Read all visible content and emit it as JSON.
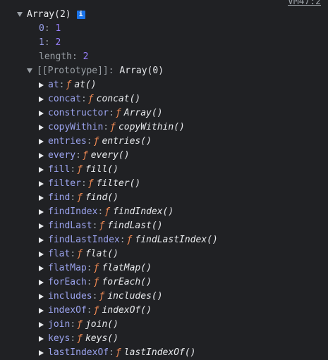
{
  "source_link": "VM47:2",
  "array_header": "Array(2)",
  "info_badge": "i",
  "entries": [
    {
      "key": "0",
      "value": "1"
    },
    {
      "key": "1",
      "value": "2"
    }
  ],
  "length": {
    "key": "length",
    "value": "2"
  },
  "prototype": {
    "key": "[[Prototype]]",
    "value": "Array(0)"
  },
  "function_symbol": "ƒ",
  "methods": [
    {
      "key": "at",
      "sig": "at()"
    },
    {
      "key": "concat",
      "sig": "concat()"
    },
    {
      "key": "constructor",
      "sig": "Array()"
    },
    {
      "key": "copyWithin",
      "sig": "copyWithin()"
    },
    {
      "key": "entries",
      "sig": "entries()"
    },
    {
      "key": "every",
      "sig": "every()"
    },
    {
      "key": "fill",
      "sig": "fill()"
    },
    {
      "key": "filter",
      "sig": "filter()"
    },
    {
      "key": "find",
      "sig": "find()"
    },
    {
      "key": "findIndex",
      "sig": "findIndex()"
    },
    {
      "key": "findLast",
      "sig": "findLast()"
    },
    {
      "key": "findLastIndex",
      "sig": "findLastIndex()"
    },
    {
      "key": "flat",
      "sig": "flat()"
    },
    {
      "key": "flatMap",
      "sig": "flatMap()"
    },
    {
      "key": "forEach",
      "sig": "forEach()"
    },
    {
      "key": "includes",
      "sig": "includes()"
    },
    {
      "key": "indexOf",
      "sig": "indexOf()"
    },
    {
      "key": "join",
      "sig": "join()"
    },
    {
      "key": "keys",
      "sig": "keys()"
    },
    {
      "key": "lastIndexOf",
      "sig": "lastIndexOf()"
    }
  ]
}
